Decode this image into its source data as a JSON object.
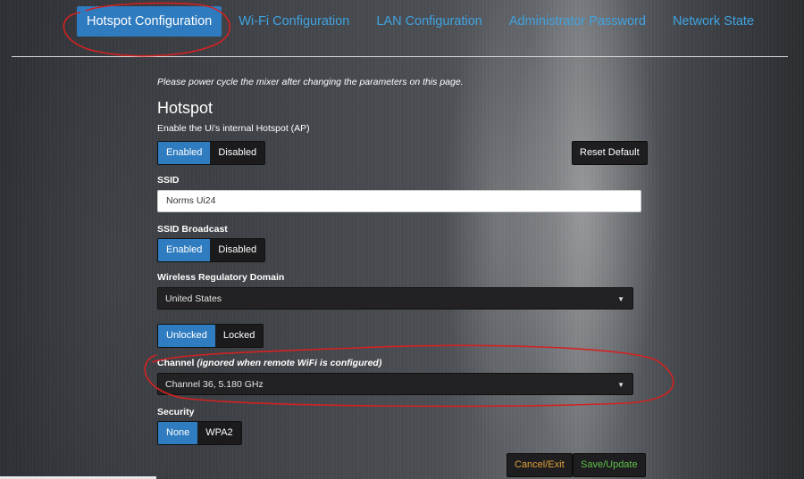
{
  "tabs": [
    {
      "label": "Hotspot Configuration",
      "active": true
    },
    {
      "label": "Wi-Fi Configuration",
      "active": false
    },
    {
      "label": "LAN Configuration",
      "active": false
    },
    {
      "label": "Administrator Password",
      "active": false
    },
    {
      "label": "Network State",
      "active": false
    }
  ],
  "notice": "Please power cycle the mixer after changing the parameters on this page.",
  "section_title": "Hotspot",
  "hotspot": {
    "enable_label": "Enable the Ui's internal Hotspot (AP)",
    "enabled": "Enabled",
    "disabled": "Disabled",
    "selected": "Enabled",
    "reset_default": "Reset Default"
  },
  "ssid": {
    "label": "SSID",
    "value": "Norms Ui24"
  },
  "ssid_broadcast": {
    "label": "SSID Broadcast",
    "enabled": "Enabled",
    "disabled": "Disabled",
    "selected": "Enabled"
  },
  "regulatory": {
    "label": "Wireless Regulatory Domain",
    "value": "United States",
    "unlocked": "Unlocked",
    "locked": "Locked",
    "selected": "Unlocked"
  },
  "channel": {
    "label": "Channel",
    "label_note": "(ignored when remote WiFi is configured)",
    "value": "Channel 36, 5.180 GHz"
  },
  "security": {
    "label": "Security",
    "none": "None",
    "wpa2": "WPA2",
    "selected": "None"
  },
  "actions": {
    "cancel": "Cancel/Exit",
    "save": "Save/Update"
  },
  "colors": {
    "accent": "#2f7cc0",
    "tab_link": "#3fa3e0",
    "cancel": "#e0a23a",
    "save": "#5fbf4a",
    "annotation": "#d32222"
  },
  "icons": {
    "select_caret": "caret-down-icon"
  }
}
